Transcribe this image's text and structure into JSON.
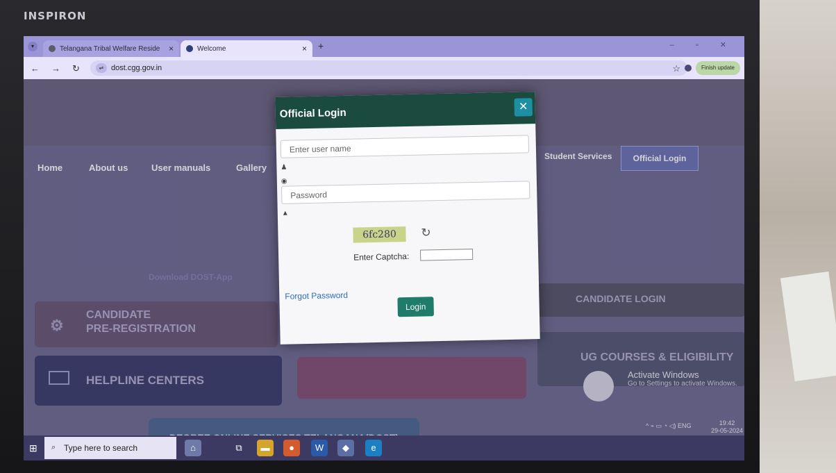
{
  "device": {
    "brand": "INSPIRON"
  },
  "browser": {
    "tabs": [
      {
        "label": "Telangana Tribal Welfare Reside",
        "close": "×"
      },
      {
        "label": "Welcome",
        "close": "×"
      }
    ],
    "new_tab": "+",
    "url": "dost.cgg.gov.in",
    "finish_update": "Finish update"
  },
  "site": {
    "menu": [
      "Home",
      "About us",
      "User manuals",
      "Gallery"
    ],
    "student_services": "Student Services",
    "official_login": "Official Login",
    "download_app": "Download DOST-App",
    "tiles": {
      "candidate_pre_reg_1": "CANDIDATE",
      "candidate_pre_reg_2": "PRE-REGISTRATION",
      "helpline": "HELPLINE CENTERS",
      "candidate_login": "CANDIDATE LOGIN",
      "ug_courses": "UG COURSES & ELIGIBILITY"
    },
    "banner": "DEGREE ONLINE SERVICES TELANGANA(DOST)"
  },
  "modal": {
    "title": "Official Login",
    "close": "✕",
    "username_placeholder": "Enter user name",
    "password_placeholder": "Password",
    "captcha_text": "6fc280",
    "captcha_label": "Enter Captcha:",
    "forgot_password": "Forgot Password",
    "login_button": "Login"
  },
  "windows": {
    "activate_title": "Activate Windows",
    "activate_sub": "Go to Settings to activate Windows.",
    "search_placeholder": "Type here to search",
    "time": "19:42",
    "date": "29-05-2024",
    "lang": "ENG"
  }
}
